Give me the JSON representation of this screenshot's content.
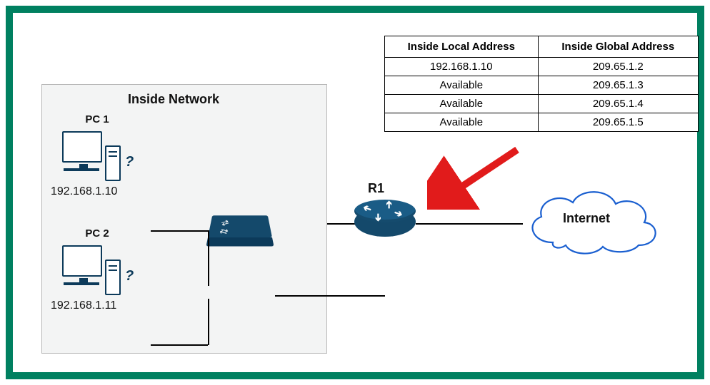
{
  "diagram": {
    "inside_network_title": "Inside Network",
    "pc1": {
      "label": "PC 1",
      "ip": "192.168.1.10"
    },
    "pc2": {
      "label": "PC 2",
      "ip": "192.168.1.11"
    },
    "router_label": "R1",
    "cloud_label": "Internet",
    "question_mark": "?"
  },
  "nat_table": {
    "headers": {
      "col1": "Inside Local Address",
      "col2": "Inside Global Address"
    },
    "rows": [
      {
        "local": "192.168.1.10",
        "global": "209.65.1.2"
      },
      {
        "local": "Available",
        "global": "209.65.1.3"
      },
      {
        "local": "Available",
        "global": "209.65.1.4"
      },
      {
        "local": "Available",
        "global": "209.65.1.5"
      }
    ]
  },
  "colors": {
    "border": "#008060",
    "device": "#14496b",
    "cloud_stroke": "#1a5fd0",
    "arrow": "#e11b1b"
  }
}
